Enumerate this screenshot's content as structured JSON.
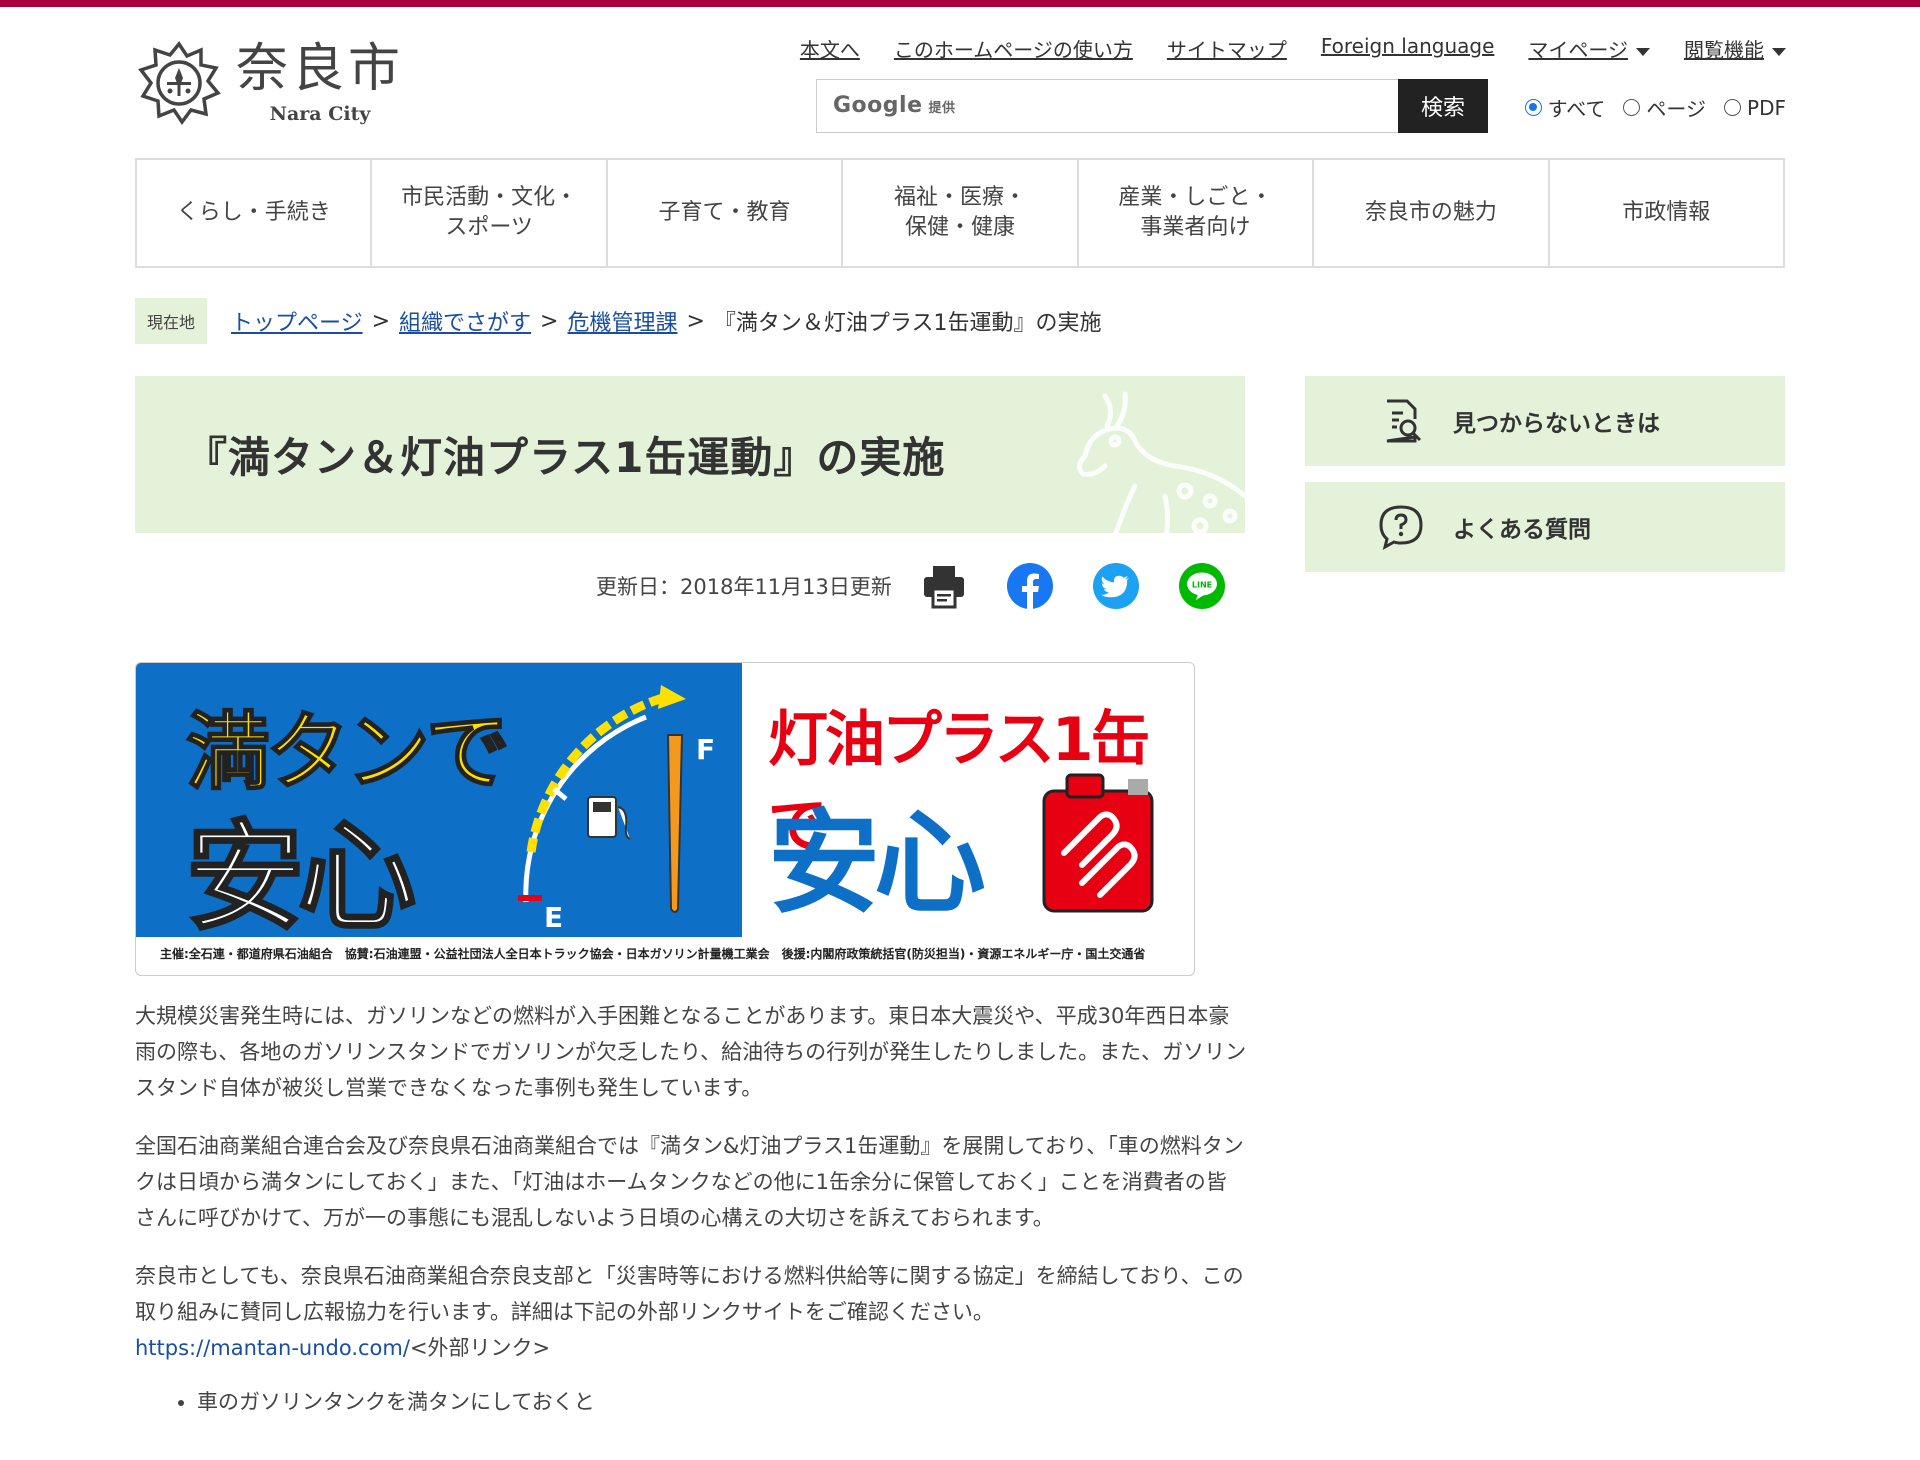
{
  "site": {
    "name": "奈良市",
    "name_en": "Nara City"
  },
  "util_links": [
    "本文へ",
    "このホームページの使い方",
    "サイトマップ",
    "Foreign language",
    "マイページ",
    "閲覧機能"
  ],
  "search": {
    "brand": "Google",
    "brand_suffix": "提供",
    "placeholder": "",
    "button": "検索",
    "scopes": [
      {
        "label": "すべて",
        "selected": true
      },
      {
        "label": "ページ",
        "selected": false
      },
      {
        "label": "PDF",
        "selected": false
      }
    ]
  },
  "global_nav": [
    "くらし・手続き",
    "市民活動・文化・\nスポーツ",
    "子育て・教育",
    "福祉・医療・\n保健・健康",
    "産業・しごと・\n事業者向け",
    "奈良市の魅力",
    "市政情報"
  ],
  "breadcrumb": {
    "badge": "現在地",
    "links": [
      "トップページ",
      "組織でさがす",
      "危機管理課"
    ],
    "separator": ">",
    "current": "『満タン＆灯油プラス1缶運動』の実施"
  },
  "page": {
    "title": "『満タン＆灯油プラス1缶運動』の実施",
    "updated": "更新日：2018年11月13日更新"
  },
  "share_icons": [
    "print-icon",
    "facebook-icon",
    "twitter-icon",
    "line-icon"
  ],
  "promo": {
    "left_top": "満タンで",
    "left_bottom": "安心",
    "gauge_full": "F",
    "gauge_empty": "E",
    "right_top": "灯油プラス1缶で",
    "right_bottom": "安心",
    "credit": "主催:全石連・都道府県石油組合　協賛:石油連盟・公益社団法人全日本トラック協会・日本ガソリン計量機工業会　後援:内閣府政策統括官(防災担当)・資源エネルギー庁・国土交通省",
    "colors": {
      "blue": "#0d70c6",
      "yellow": "#ffe000",
      "red": "#e60012",
      "orange": "#f39a1e"
    }
  },
  "body": {
    "p1": "大規模災害発生時には、ガソリンなどの燃料が入手困難となることがあります。東日本大震災や、平成30年西日本豪雨の際も、各地のガソリンスタンドでガソリンが欠乏したり、給油待ちの行列が発生したりしました。また、ガソリンスタンド自体が被災し営業できなくなった事例も発生しています。",
    "p2": "全国石油商業組合連合会及び奈良県石油商業組合では『満タン&灯油プラス1缶運動』を展開しており、「車の燃料タンクは日頃から満タンにしておく」また、「灯油はホームタンクなどの他に1缶余分に保管しておく」ことを消費者の皆さんに呼びかけて、万が一の事態にも混乱しないよう日頃の心構えの大切さを訴えておられます。",
    "p3": "奈良市としても、奈良県石油商業組合奈良支部と「災害時等における燃料供給等に関する協定」を締結しており、この取り組みに賛同し広報協力を行います。詳細は下記の外部リンクサイトをご確認ください。",
    "link": "https://mantan-undo.com/",
    "link_note": "<外部リンク>",
    "list": [
      "車のガソリンタンクを満タンにしておくと"
    ]
  },
  "sidebar": [
    {
      "label": "見つからないときは",
      "icon": "search-document-icon"
    },
    {
      "label": "よくある質問",
      "icon": "question-bubble-icon"
    }
  ],
  "theme": {
    "accent": "#a8003b",
    "panel": "#e3f2d9",
    "link": "#1a4fa0"
  }
}
